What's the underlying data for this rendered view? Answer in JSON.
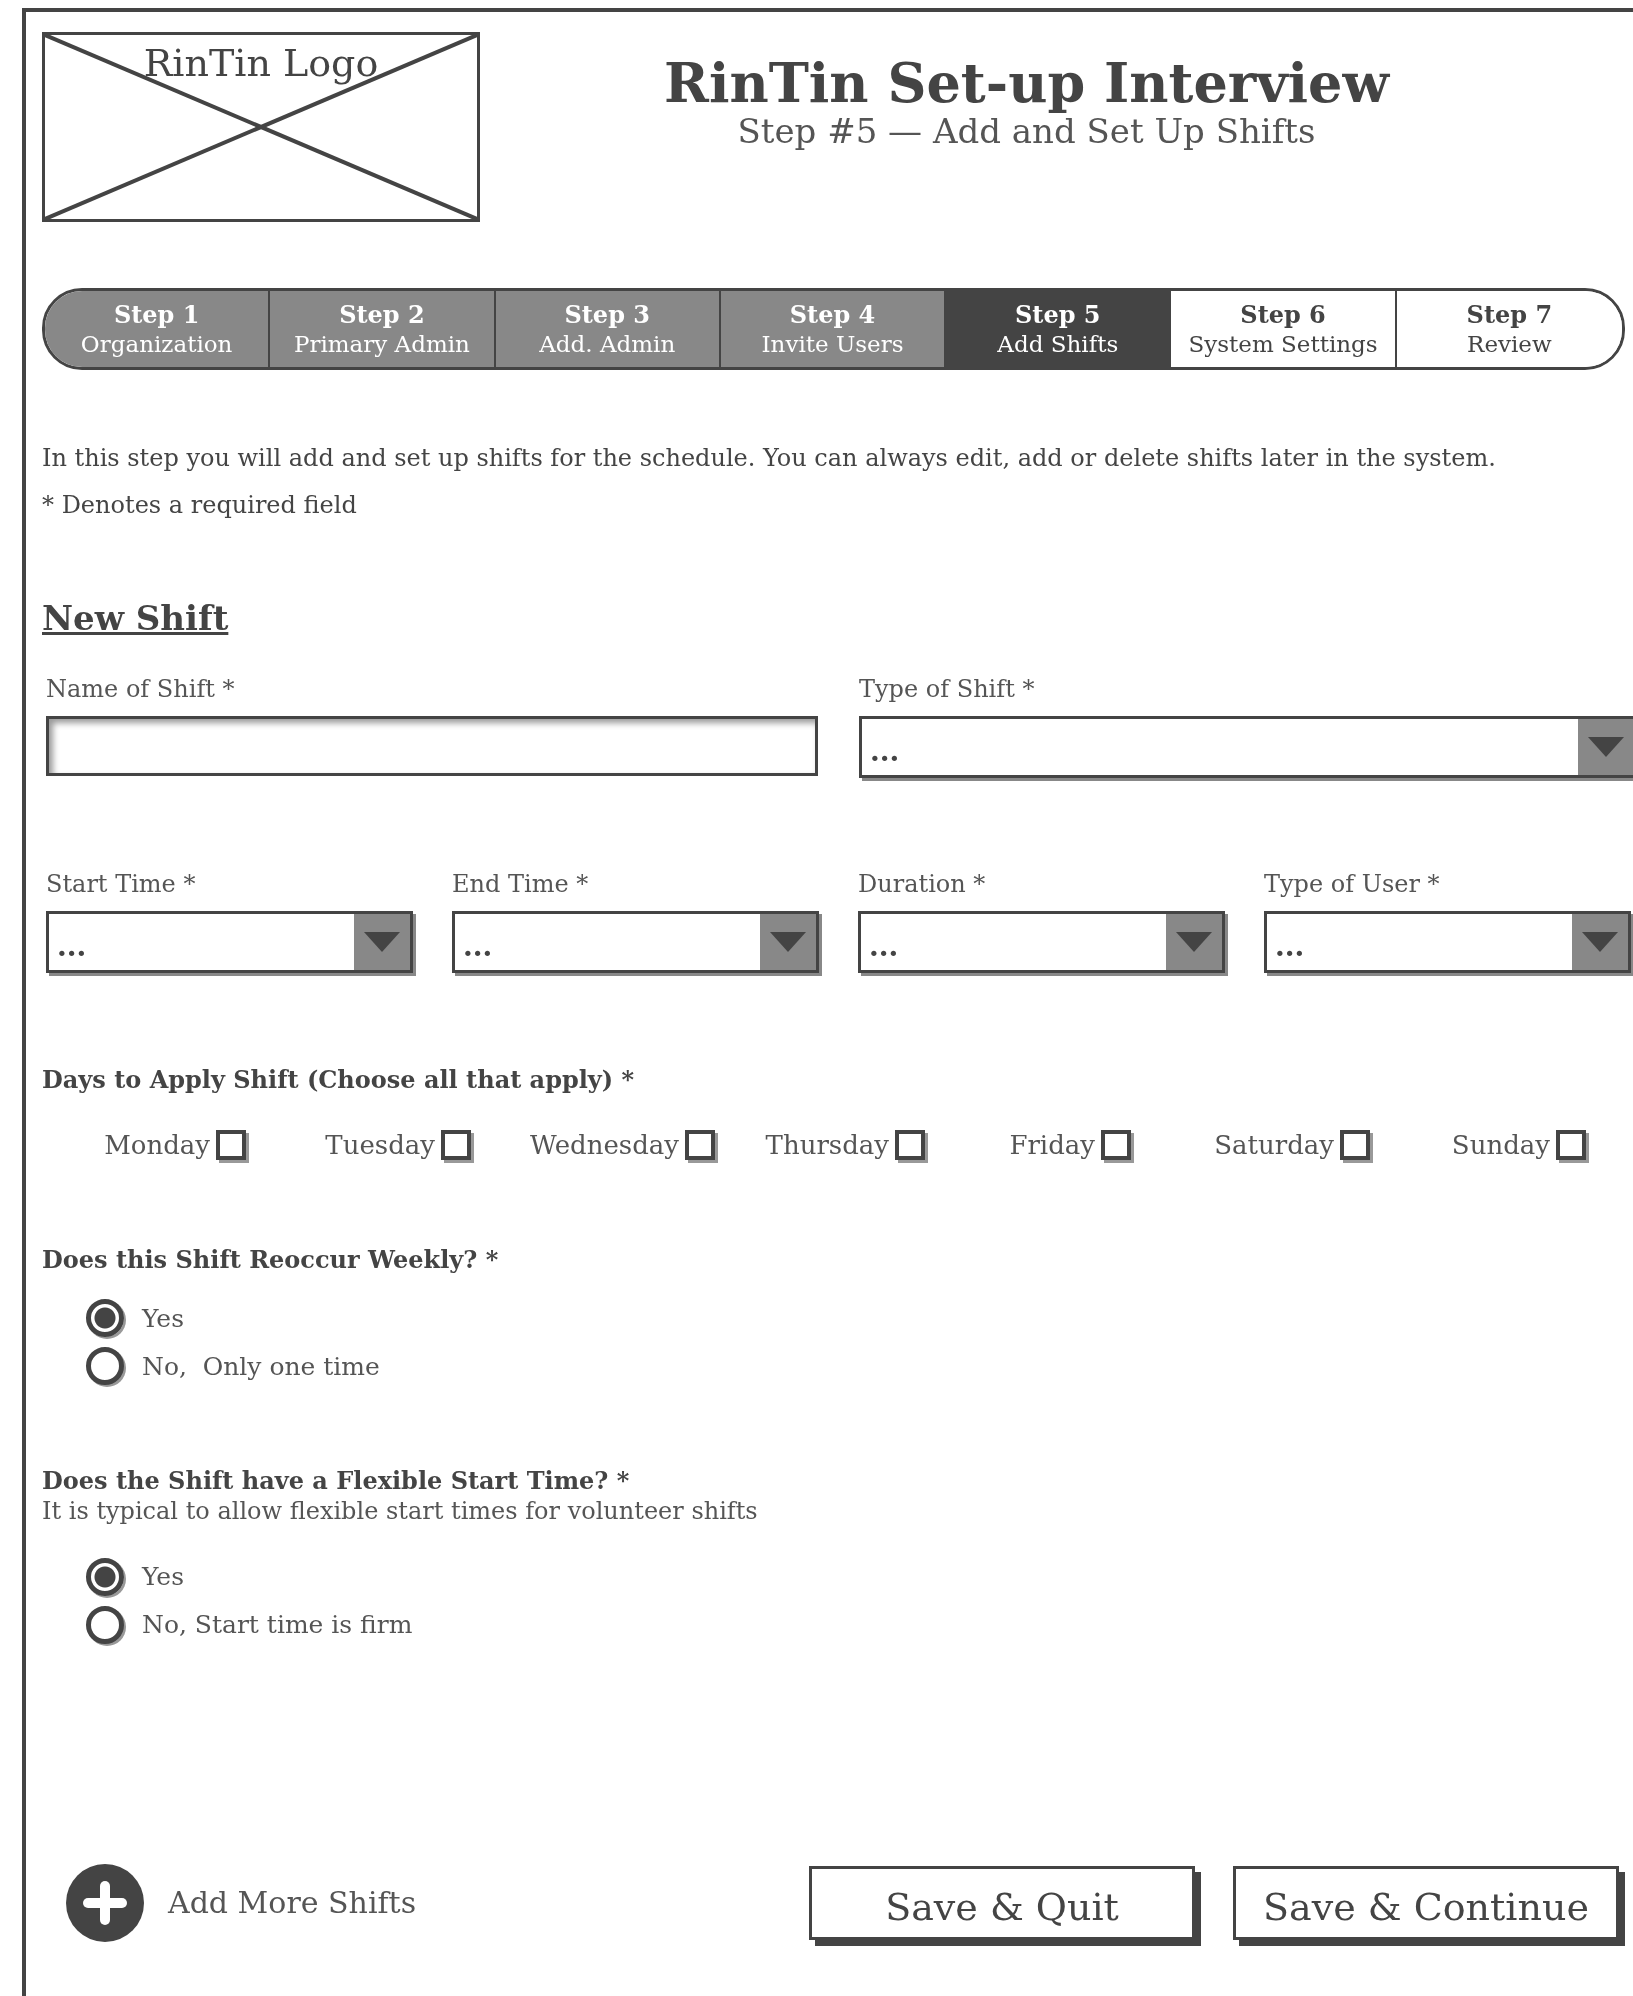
{
  "logo": {
    "label": "RinTin Logo"
  },
  "title": "RinTin Set-up Interview",
  "subtitle": "Step #5 — Add and Set Up Shifts",
  "steps": [
    {
      "number": "Step 1",
      "label": "Organization",
      "completed": true,
      "selected": false
    },
    {
      "number": "Step 2",
      "label": "Primary Admin",
      "completed": true,
      "selected": false
    },
    {
      "number": "Step 3",
      "label": "Add. Admin",
      "completed": true,
      "selected": false
    },
    {
      "number": "Step 4",
      "label": "Invite Users",
      "completed": true,
      "selected": false
    },
    {
      "number": "Step 5",
      "label": "Add Shifts",
      "completed": false,
      "selected": true
    },
    {
      "number": "Step 6",
      "label": "System Settings",
      "completed": false,
      "selected": false
    },
    {
      "number": "Step 7",
      "label": "Review",
      "completed": false,
      "selected": false
    }
  ],
  "intro": "In this step you will add and set up shifts for the schedule. You can always edit, add or delete shifts later in the system.",
  "required_note": "* Denotes a required field",
  "section_title": "New Shift",
  "field_rows": [
    [
      {
        "label": "Name of Shift *",
        "kind": "text"
      },
      {
        "label": "Type of Shift *",
        "kind": "dropdown",
        "value": "..."
      }
    ],
    [
      {
        "label": "Start Time *",
        "kind": "dropdown",
        "value": "..."
      },
      {
        "label": "End Time *",
        "kind": "dropdown",
        "value": "..."
      },
      {
        "label": "Duration *",
        "kind": "dropdown",
        "value": "..."
      },
      {
        "label": "Type of User *",
        "kind": "dropdown",
        "value": "..."
      }
    ]
  ],
  "days": {
    "label": "Days to Apply Shift (Choose all that apply) *",
    "options": [
      {
        "label": "Monday",
        "checked": false
      },
      {
        "label": "Tuesday",
        "checked": false
      },
      {
        "label": "Wednesday",
        "checked": false
      },
      {
        "label": "Thursday",
        "checked": false
      },
      {
        "label": "Friday",
        "checked": false
      },
      {
        "label": "Saturday",
        "checked": false
      },
      {
        "label": "Sunday",
        "checked": false
      }
    ]
  },
  "questions": [
    {
      "label": "Does this Shift Reoccur Weekly? *",
      "options": [
        {
          "label": "Yes",
          "selected": true
        },
        {
          "label": "No,  Only one time",
          "selected": false
        }
      ]
    },
    {
      "label": "Does the Shift have a Flexible Start Time? *",
      "hint": "It is typical to allow flexible start times for volunteer shifts",
      "options": [
        {
          "label": "Yes",
          "selected": true
        },
        {
          "label": "No, Start time is firm",
          "selected": false
        }
      ]
    }
  ],
  "add_more": {
    "label": "Add More Shifts"
  },
  "buttons": [
    "Save & Quit",
    "Save & Continue"
  ]
}
